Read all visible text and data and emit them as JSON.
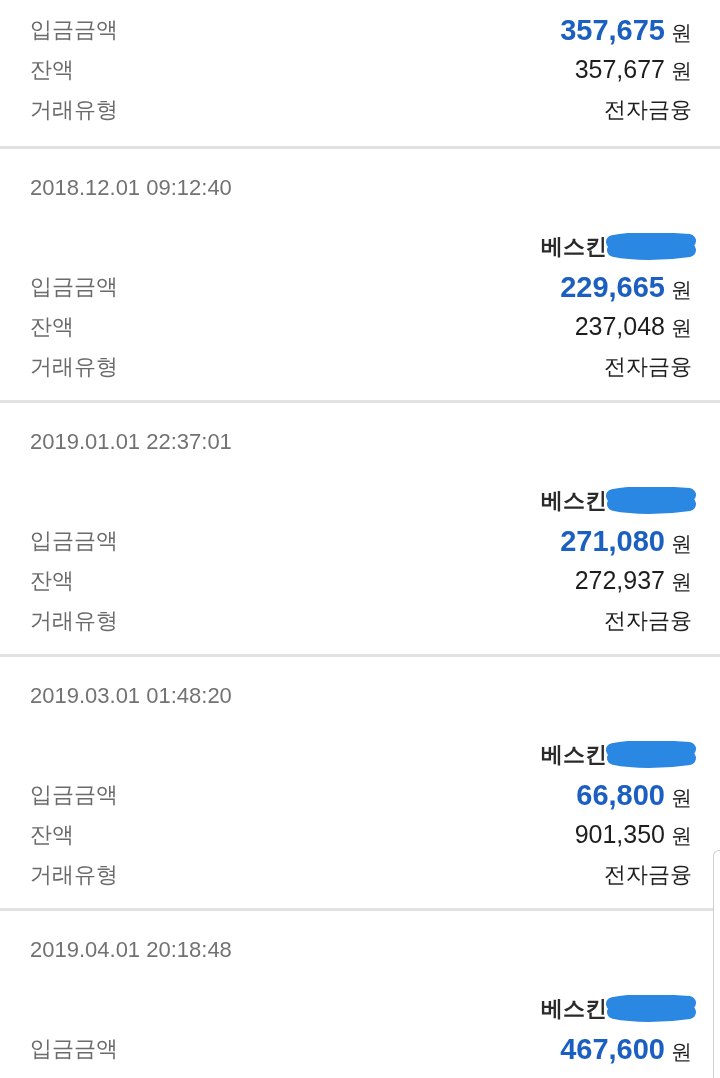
{
  "transactions": [
    {
      "rows": [
        {
          "kind": "deposit",
          "label": "입금금액",
          "value": "357,675",
          "unit": "원"
        },
        {
          "kind": "balance",
          "label": "잔액",
          "value": "357,677",
          "unit": "원"
        },
        {
          "kind": "type",
          "label": "거래유형",
          "value": "전자금융"
        }
      ]
    },
    {
      "datetime": "2018.12.01 09:12:40",
      "counterparty": {
        "name": "베스킨",
        "redacted": true
      },
      "rows": [
        {
          "kind": "deposit",
          "label": "입금금액",
          "value": "229,665",
          "unit": "원"
        },
        {
          "kind": "balance",
          "label": "잔액",
          "value": "237,048",
          "unit": "원"
        },
        {
          "kind": "type",
          "label": "거래유형",
          "value": "전자금융"
        }
      ]
    },
    {
      "datetime": "2019.01.01 22:37:01",
      "counterparty": {
        "name": "베스킨",
        "redacted": true
      },
      "rows": [
        {
          "kind": "deposit",
          "label": "입금금액",
          "value": "271,080",
          "unit": "원"
        },
        {
          "kind": "balance",
          "label": "잔액",
          "value": "272,937",
          "unit": "원"
        },
        {
          "kind": "type",
          "label": "거래유형",
          "value": "전자금융"
        }
      ]
    },
    {
      "datetime": "2019.03.01 01:48:20",
      "counterparty": {
        "name": "베스킨",
        "redacted": true
      },
      "rows": [
        {
          "kind": "deposit",
          "label": "입금금액",
          "value": "66,800",
          "unit": "원"
        },
        {
          "kind": "balance",
          "label": "잔액",
          "value": "901,350",
          "unit": "원"
        },
        {
          "kind": "type",
          "label": "거래유형",
          "value": "전자금융"
        }
      ]
    },
    {
      "datetime": "2019.04.01 20:18:48",
      "counterparty": {
        "name": "베스킨",
        "redacted": true
      },
      "rows": [
        {
          "kind": "deposit",
          "label": "입금금액",
          "value": "467,600",
          "unit": "원"
        }
      ]
    }
  ]
}
